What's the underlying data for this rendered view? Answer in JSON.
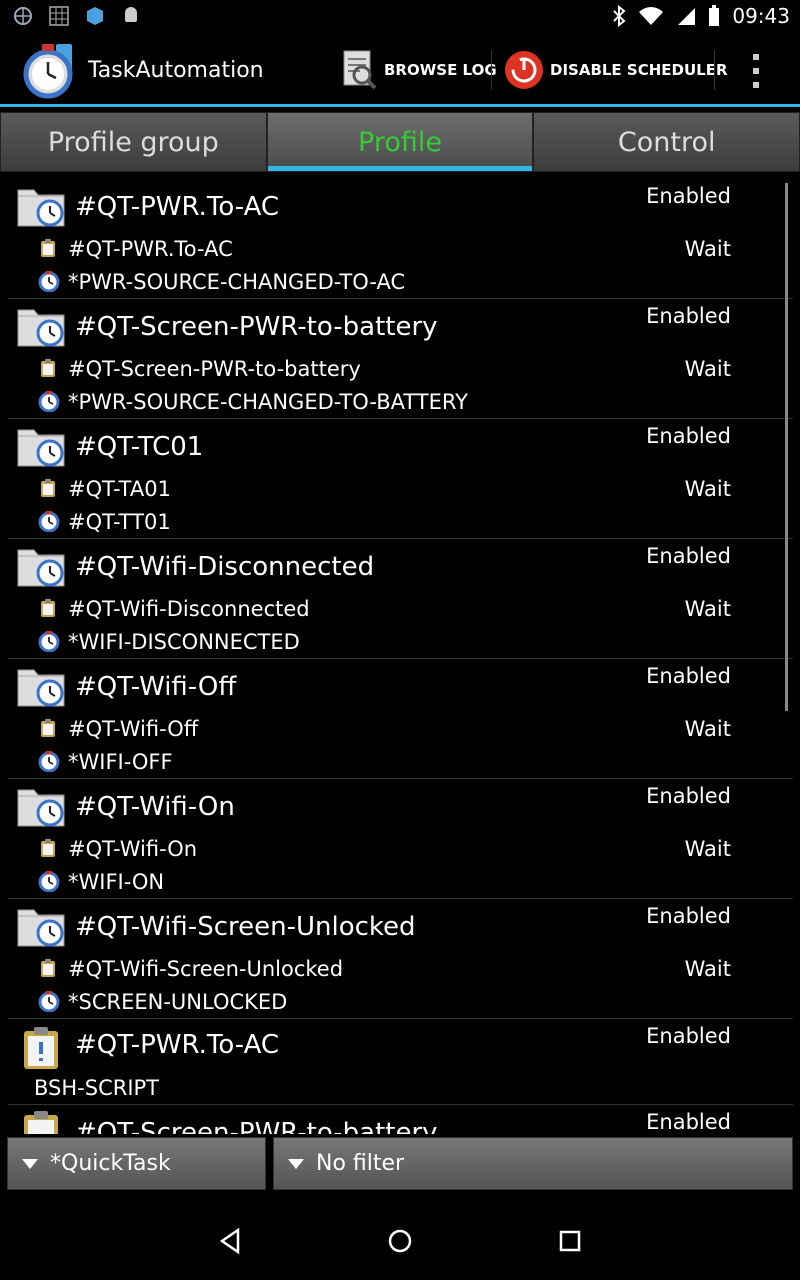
{
  "status_bar": {
    "time": "09:43",
    "icons": [
      "globe-icon",
      "grid-icon",
      "box-icon",
      "android-icon",
      "bluetooth-icon",
      "wifi-icon",
      "signal-icon",
      "battery-icon"
    ]
  },
  "action_bar": {
    "title": "TaskAutomation",
    "browse_log_label": "BROWSE LOG",
    "disable_scheduler_label": "DISABLE SCHEDULER"
  },
  "tabs": [
    {
      "label": "Profile group",
      "active": false
    },
    {
      "label": "Profile",
      "active": true
    },
    {
      "label": "Control",
      "active": false
    }
  ],
  "items": [
    {
      "title": "#QT-PWR.To-AC",
      "status": "Enabled",
      "task": "#QT-PWR.To-AC",
      "task_status": "Wait",
      "trigger": "*PWR-SOURCE-CHANGED-TO-AC"
    },
    {
      "title": "#QT-Screen-PWR-to-battery",
      "status": "Enabled",
      "task": "#QT-Screen-PWR-to-battery",
      "task_status": "Wait",
      "trigger": "*PWR-SOURCE-CHANGED-TO-BATTERY"
    },
    {
      "title": "#QT-TC01",
      "status": "Enabled",
      "task": "#QT-TA01",
      "task_status": "Wait",
      "trigger": "#QT-TT01"
    },
    {
      "title": "#QT-Wifi-Disconnected",
      "status": "Enabled",
      "task": "#QT-Wifi-Disconnected",
      "task_status": "Wait",
      "trigger": "*WIFI-DISCONNECTED"
    },
    {
      "title": "#QT-Wifi-Off",
      "status": "Enabled",
      "task": "#QT-Wifi-Off",
      "task_status": "Wait",
      "trigger": "*WIFI-OFF"
    },
    {
      "title": "#QT-Wifi-On",
      "status": "Enabled",
      "task": "#QT-Wifi-On",
      "task_status": "Wait",
      "trigger": "*WIFI-ON"
    },
    {
      "title": "#QT-Wifi-Screen-Unlocked",
      "status": "Enabled",
      "task": "#QT-Wifi-Screen-Unlocked",
      "task_status": "Wait",
      "trigger": "*SCREEN-UNLOCKED"
    }
  ],
  "task_item": {
    "title": "#QT-PWR.To-AC",
    "status": "Enabled",
    "script": "BSH-SCRIPT"
  },
  "partial_item": {
    "title": "#QT-Screen-PWR-to-battery",
    "status": "Enabled"
  },
  "filters": {
    "group": "*QuickTask",
    "filter": "No filter"
  },
  "colors": {
    "accent": "#33b5e5",
    "active_tab": "#33cc33"
  }
}
